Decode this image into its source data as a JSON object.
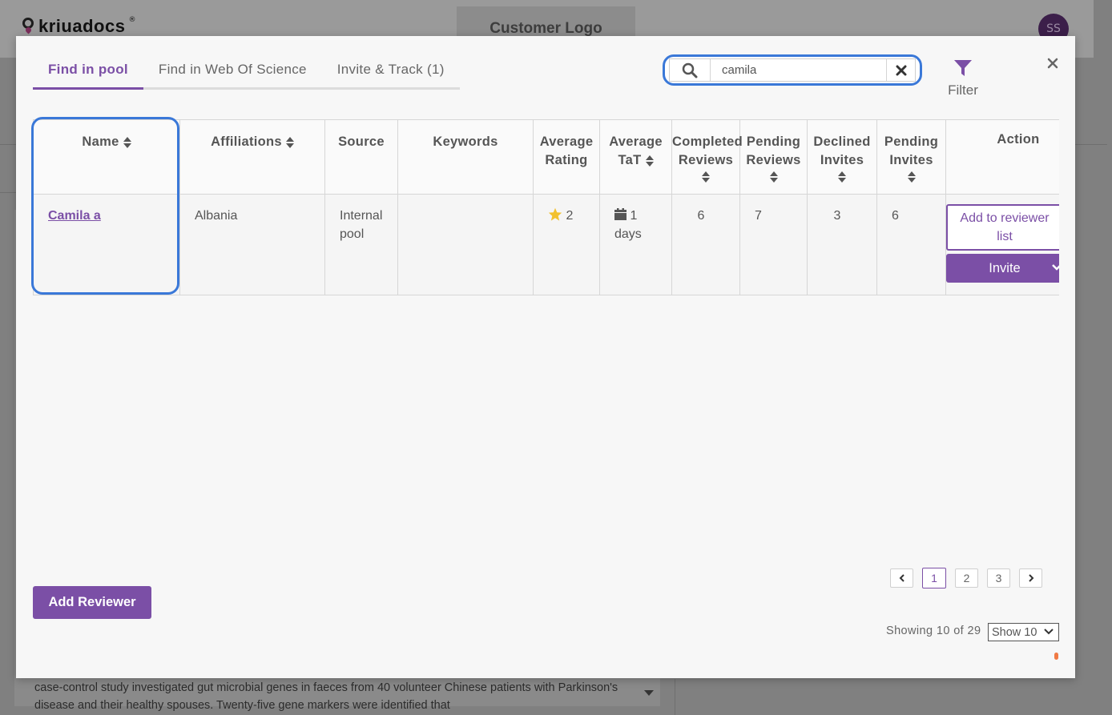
{
  "background": {
    "logo_text": "kriuadocs",
    "logo_reg": "®",
    "customer_logo": "Customer Logo",
    "avatar_initials": "SS",
    "abstract_text": "case-control study investigated gut microbial genes in faeces from 40 volunteer Chinese patients with Parkinson's disease and their healthy spouses. Twenty-five gene markers were identified that"
  },
  "modal": {
    "tabs": [
      {
        "label": "Find in pool",
        "active": true
      },
      {
        "label": "Find in Web Of Science",
        "active": false
      },
      {
        "label": "Invite & Track (1)",
        "active": false
      }
    ],
    "search": {
      "value": "camila",
      "placeholder": ""
    },
    "filter_label": "Filter",
    "close_icon": "close-icon",
    "accent_color": "#7b4fa6",
    "highlight_color": "#3a78d8"
  },
  "table": {
    "headers": {
      "name": "Name",
      "affiliations": "Affiliations",
      "source": "Source",
      "keywords": "Keywords",
      "avg_rating_1": "Average",
      "avg_rating_2": "Rating",
      "avg_tat_1": "Average",
      "avg_tat_2": "TaT",
      "completed_1": "Completed",
      "completed_2": "Reviews",
      "pending_reviews_1": "Pending",
      "pending_reviews_2": "Reviews",
      "declined_1": "Declined",
      "declined_2": "Invites",
      "pending_invites_1": "Pending",
      "pending_invites_2": "Invites",
      "action": "Action"
    },
    "rows": [
      {
        "name": "Camila a",
        "affiliation": "Albania",
        "source_1": "Internal",
        "source_2": "pool",
        "keywords": "",
        "rating": "2",
        "tat_1": "1",
        "tat_2": "days",
        "completed": "6",
        "pending_reviews": "7",
        "declined": "3",
        "pending_invites": "6",
        "add_label_1": "Add to reviewer",
        "add_label_2": "list",
        "invite_label": "Invite"
      }
    ]
  },
  "footer": {
    "add_reviewer": "Add Reviewer",
    "pages": [
      "1",
      "2",
      "3"
    ],
    "current_page": "1",
    "showing": "Showing 10 of 29",
    "show_select": "Show 10"
  }
}
